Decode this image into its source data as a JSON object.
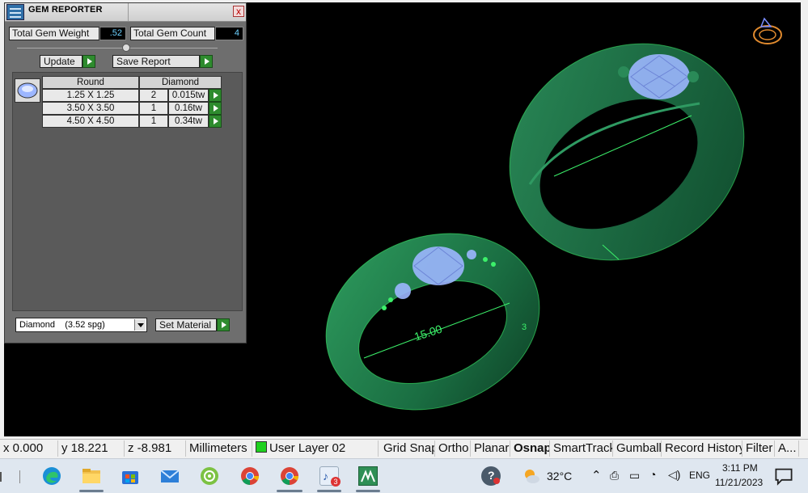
{
  "panel": {
    "title": "GEM REPORTER",
    "close_label": "x",
    "total_weight_label": "Total Gem Weight",
    "total_weight_value": ".52",
    "total_count_label": "Total Gem Count",
    "total_count_value": "4",
    "update_label": "Update",
    "save_report_label": "Save Report",
    "table": {
      "headers": [
        "Round",
        "Diamond"
      ],
      "rows": [
        {
          "size": "1.25 X 1.25",
          "count": "2",
          "weight": "0.015tw"
        },
        {
          "size": "3.50 X 3.50",
          "count": "1",
          "weight": "0.16tw"
        },
        {
          "size": "4.50 X 4.50",
          "count": "1",
          "weight": "0.34tw"
        }
      ]
    },
    "material_select": "Diamond    (3.52 spg)",
    "set_material_label": "Set Material"
  },
  "viewport": {
    "dimension_label_main": "15.00",
    "dimension_label_side": "3"
  },
  "statusbar": {
    "x": "x 0.000",
    "y": "y 18.221",
    "z": "z -8.981",
    "units": "Millimeters",
    "layer": "User Layer 02",
    "toggles": [
      "Grid Snap",
      "Ortho",
      "Planar",
      "Osnap",
      "SmartTrack",
      "Gumball",
      "Record History",
      "Filter",
      "A..."
    ],
    "bold_toggle": "Osnap"
  },
  "taskbar": {
    "apps": [
      "edge-icon",
      "file-explorer-icon",
      "microsoft-store-icon",
      "mail-icon",
      "app-green-icon",
      "chrome-icon",
      "chrome-profile-icon",
      "app-badge-icon",
      "matrix-app-icon"
    ],
    "badge_count": "3",
    "weather_temp": "32°C",
    "language": "ENG",
    "time": "3:11 PM",
    "date": "11/21/2023"
  },
  "colors": {
    "ring_green": "#1e6e44",
    "ring_wire": "#3cf06a",
    "gem_blue": "#9cb6ff",
    "panel_bg": "#6e6e6e"
  }
}
